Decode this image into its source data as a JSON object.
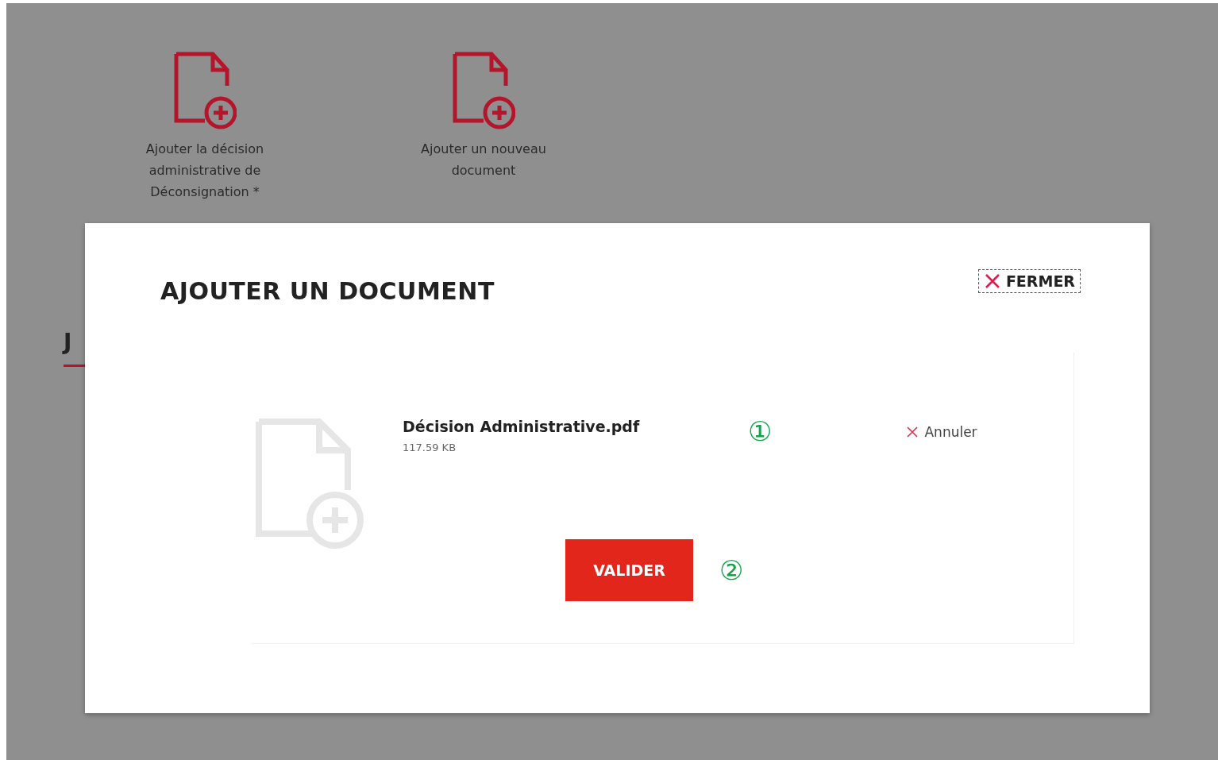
{
  "background": {
    "actions": [
      {
        "label": "Ajouter la décision administrative de Déconsignation *"
      },
      {
        "label": "Ajouter un nouveau document"
      }
    ],
    "section_heading": "J"
  },
  "modal": {
    "title": "AJOUTER UN DOCUMENT",
    "close_button": "FERMER",
    "file": {
      "name": "Décision Administrative.pdf",
      "size": "117.59 KB",
      "cancel": "Annuler"
    },
    "submit_button": "VALIDER",
    "annotations": [
      "①",
      "②"
    ]
  }
}
